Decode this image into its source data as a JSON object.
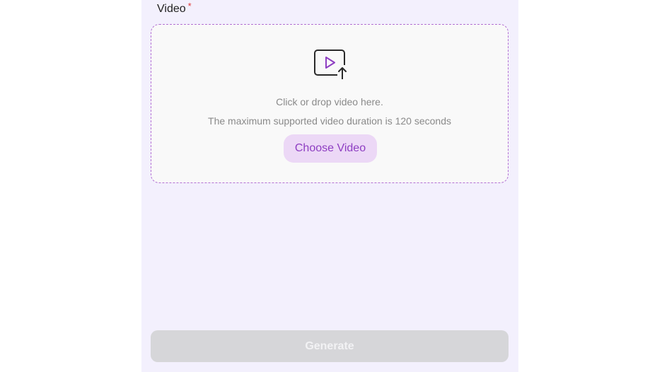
{
  "video_field": {
    "label": "Video",
    "required_mark": "*"
  },
  "dropzone": {
    "icon": "video-upload-icon",
    "hint_primary": "Click or drop video here.",
    "hint_secondary": "The maximum supported video duration is 120 seconds",
    "choose_label": "Choose Video"
  },
  "actions": {
    "generate_label": "Generate"
  },
  "colors": {
    "panel_background": "#f3f0fd",
    "accent_purple": "#8e3ec2",
    "dropzone_border": "#b270d3",
    "required_red": "#e03a3a",
    "disabled_button": "#d6d6d9"
  }
}
